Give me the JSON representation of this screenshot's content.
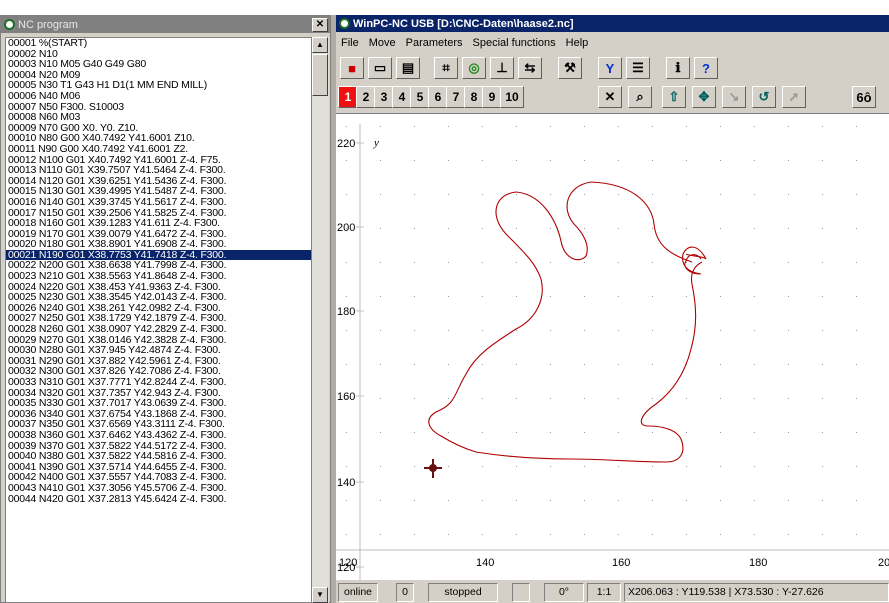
{
  "nc_window": {
    "title": "NC program",
    "lines": [
      "00001 %(START)",
      "00002 N10",
      "00003 N10 M05 G40 G49 G80",
      "00004 N20 M09",
      "00005 N30 T1 G43 H1 D1(1 MM END MILL)",
      "00006 N40 M06",
      "00007 N50 F300. S10003",
      "00008 N60 M03",
      "00009 N70 G00 X0. Y0. Z10.",
      "00010 N80 G00 X40.7492 Y41.6001 Z10.",
      "00011 N90 G00 X40.7492 Y41.6001 Z2.",
      "00012 N100 G01 X40.7492 Y41.6001 Z-4. F75.",
      "00013 N110 G01 X39.7507 Y41.5464 Z-4. F300.",
      "00014 N120 G01 X39.6251 Y41.5436 Z-4. F300.",
      "00015 N130 G01 X39.4995 Y41.5487 Z-4. F300.",
      "00016 N140 G01 X39.3745 Y41.5617 Z-4. F300.",
      "00017 N150 G01 X39.2506 Y41.5825 Z-4. F300.",
      "00018 N160 G01 X39.1283 Y41.611 Z-4. F300.",
      "00019 N170 G01 X39.0079 Y41.6472 Z-4. F300.",
      "00020 N180 G01 X38.8901 Y41.6908 Z-4. F300.",
      "00021 N190 G01 X38.7753 Y41.7418 Z-4. F300.",
      "00022 N200 G01 X38.6638 Y41.7998 Z-4. F300.",
      "00023 N210 G01 X38.5563 Y41.8648 Z-4. F300.",
      "00024 N220 G01 X38.453 Y41.9363 Z-4. F300.",
      "00025 N230 G01 X38.3545 Y42.0143 Z-4. F300.",
      "00026 N240 G01 X38.261 Y42.0982 Z-4. F300.",
      "00027 N250 G01 X38.1729 Y42.1879 Z-4. F300.",
      "00028 N260 G01 X38.0907 Y42.2829 Z-4. F300.",
      "00029 N270 G01 X38.0146 Y42.3828 Z-4. F300.",
      "00030 N280 G01 X37.945 Y42.4874 Z-4. F300.",
      "00031 N290 G01 X37.882 Y42.5961 Z-4. F300.",
      "00032 N300 G01 X37.826 Y42.7086 Z-4. F300.",
      "00033 N310 G01 X37.7771 Y42.8244 Z-4. F300.",
      "00034 N320 G01 X37.7357 Y42.943 Z-4. F300.",
      "00035 N330 G01 X37.7017 Y43.0639 Z-4. F300.",
      "00036 N340 G01 X37.6754 Y43.1868 Z-4. F300.",
      "00037 N350 G01 X37.6569 Y43.3111 Z-4. F300.",
      "00038 N360 G01 X37.6462 Y43.4362 Z-4. F300.",
      "00039 N370 G01 X37.5822 Y44.5172 Z-4. F300.",
      "00040 N380 G01 X37.5822 Y44.5816 Z-4. F300.",
      "00041 N390 G01 X37.5714 Y44.6455 Z-4. F300.",
      "00042 N400 G01 X37.5557 Y44.7083 Z-4. F300.",
      "00043 N410 G01 X37.3056 Y45.5706 Z-4. F300.",
      "00044 N420 G01 X37.2813 Y45.6424 Z-4. F300."
    ],
    "selected_index": 20,
    "selected_color": "#0a246a"
  },
  "main_window": {
    "title": "WinPC-NC USB [D:\\CNC-Daten\\haase2.nc]",
    "title_color": "#0a246a",
    "menu": [
      "File",
      "Move",
      "Parameters",
      "Special functions",
      "Help"
    ],
    "toolbar1_icons": [
      "stop-icon",
      "open-folder-icon",
      "document-icon",
      "contour-icon",
      "color-wheel-icon",
      "zero-point-icon",
      "reference-icon",
      "tool-icon",
      "filter-icon",
      "list-icon",
      "info-icon",
      "help-icon"
    ],
    "toolbar1_glyphs": [
      "■",
      "▭",
      "▤",
      "⌗",
      "◎",
      "⊥",
      "⇆",
      "⚒",
      "Y",
      "☰",
      "ℹ",
      "?"
    ],
    "view_numbers": [
      "1",
      "2",
      "3",
      "4",
      "5",
      "6",
      "7",
      "8",
      "9",
      "10"
    ],
    "active_view": "1",
    "toolbar2_icons": [
      "clear-icon",
      "zoom-icon",
      "up-arrow-icon",
      "move-icon",
      "pen-icon",
      "rotate-icon",
      "arrows-icon",
      "glasses-icon"
    ],
    "toolbar2_glyphs": [
      "✕",
      "⌕",
      "⇧",
      "✥",
      "↘",
      "↺",
      "➚",
      "6ô"
    ],
    "accent_red": "#ee1111"
  },
  "plot": {
    "y_axis_label": "y",
    "x_ticks": [
      "120",
      "140",
      "160",
      "180",
      "20"
    ],
    "y_ticks": [
      "220",
      "200",
      "180",
      "160",
      "140",
      "120"
    ],
    "path_color": "#b00000",
    "marker": "crosshair"
  },
  "status": {
    "online": "online",
    "field2": "0",
    "state": "stopped",
    "field4": "",
    "angle": "0°",
    "scale": "1:1",
    "coords": "X206.063 : Y119.538  |  X73.530 : Y-27.626"
  }
}
